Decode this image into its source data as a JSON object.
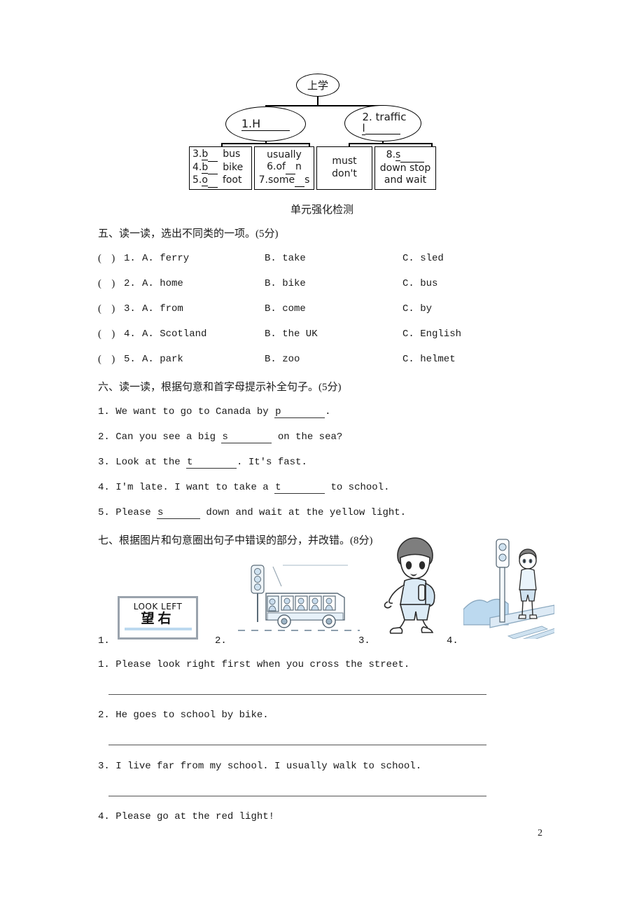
{
  "mindmap": {
    "root": "上学",
    "node1": "1.H",
    "node2_line1": "2. traffic",
    "node2_line2": "l",
    "leaf1": {
      "line1_num": "3.",
      "line1_blank": "b",
      "line1_word": "bus",
      "line2_num": "4.",
      "line2_blank": "b",
      "line2_word": "bike",
      "line3_num": "5.",
      "line3_blank": "o",
      "line3_word": "foot"
    },
    "leaf2": {
      "line1": "usually",
      "line2_num": "6.",
      "line2_a": "of",
      "line2_b": "n",
      "line3_num": "7.",
      "line3_a": "some",
      "line3_b": "s"
    },
    "leaf3": {
      "line1": "must",
      "line2": "don't"
    },
    "leaf4": {
      "line1_num": "8.",
      "line1_blank": "s",
      "line2": "down  stop",
      "line3": "and wait"
    }
  },
  "unit_title": "单元强化检测",
  "section5": {
    "heading": "五、读一读，选出不同类的一项。(5分)",
    "paren": "(",
    "paren_close": ")",
    "items": [
      {
        "num": "1.",
        "a": "A. ferry",
        "b": "B. take",
        "c": "C. sled"
      },
      {
        "num": "2.",
        "a": "A. home",
        "b": "B. bike",
        "c": "C. bus"
      },
      {
        "num": "3.",
        "a": "A. from",
        "b": "B. come",
        "c": "C. by"
      },
      {
        "num": "4.",
        "a": "A. Scotland",
        "b": "B. the UK",
        "c": "C. English"
      },
      {
        "num": "5.",
        "a": "A. park",
        "b": "B. zoo",
        "c": "C. helmet"
      }
    ]
  },
  "section6": {
    "heading": "六、读一读，根据句意和首字母提示补全句子。(5分)",
    "items": [
      {
        "num": "1.",
        "before": "We want to go to Canada by ",
        "hint": "p",
        "after": "."
      },
      {
        "num": "2.",
        "before": "Can you see a big ",
        "hint": "s",
        "after": " on the sea?"
      },
      {
        "num": "3.",
        "before": "Look at the ",
        "hint": "t",
        "after": ". It's fast."
      },
      {
        "num": "4.",
        "before": "I'm late. I want to take a ",
        "hint": "t",
        "after": " to school."
      },
      {
        "num": "5.",
        "before": "Please ",
        "hint": "s",
        "after": " down and wait at the yellow light."
      }
    ]
  },
  "section7": {
    "heading": "七、根据图片和句意圈出句子中错误的部分，并改错。(8分)",
    "pictures": [
      {
        "num": "1.",
        "caption_en": "LOOK LEFT",
        "caption_cn": "望右",
        "alt": "look-left-sign"
      },
      {
        "num": "2.",
        "alt": "bus-with-traffic-light"
      },
      {
        "num": "3.",
        "alt": "boy-walking-with-backpack"
      },
      {
        "num": "4.",
        "alt": "child-at-traffic-light"
      }
    ],
    "sentences": [
      {
        "num": "1.",
        "text": "Please look right first when you cross the street."
      },
      {
        "num": "2.",
        "text": "He goes to school by bike."
      },
      {
        "num": "3.",
        "text": "I live far from my school. I usually walk to school."
      },
      {
        "num": "4.",
        "text": "Please go at the red light!"
      }
    ]
  },
  "page_number": "2"
}
